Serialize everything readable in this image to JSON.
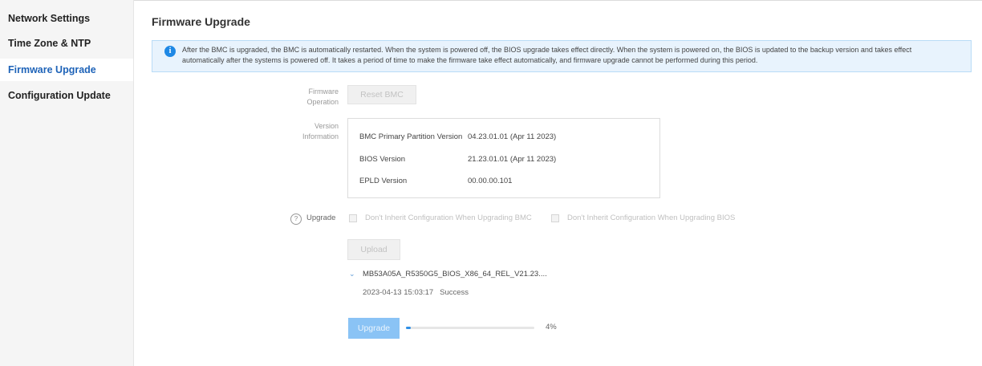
{
  "sidebar": {
    "items": [
      {
        "label": "Network Settings",
        "active": false
      },
      {
        "label": "Time Zone & NTP",
        "active": false
      },
      {
        "label": "Firmware Upgrade",
        "active": true
      },
      {
        "label": "Configuration Update",
        "active": false
      }
    ]
  },
  "main": {
    "title": "Firmware Upgrade",
    "notice": {
      "icon": "info-icon",
      "text": "After the BMC is upgraded, the BMC is automatically restarted. When the system is powered off, the BIOS upgrade takes effect directly. When the system is powered on, the BIOS is updated to the backup version and takes effect automatically after the systems is powered off. It takes a period of time to make the firmware take effect automatically, and firmware upgrade cannot be performed during this period."
    },
    "firmware_operation": {
      "label_line1": "Firmware",
      "label_line2": "Operation",
      "reset_button": "Reset BMC"
    },
    "version_information": {
      "label_line1": "Version",
      "label_line2": "Information",
      "rows": [
        {
          "name": "BMC Primary Partition Version",
          "value": "04.23.01.01  (Apr 11 2023)"
        },
        {
          "name": "BIOS Version",
          "value": "21.23.01.01  (Apr 11 2023)"
        },
        {
          "name": "EPLD Version",
          "value": "00.00.00.101"
        }
      ]
    },
    "upgrade": {
      "label": "Upgrade",
      "help_icon": "?",
      "options": [
        {
          "label": "Don't Inherit Configuration When Upgrading BMC",
          "checked": false
        },
        {
          "label": "Don't Inherit Configuration When Upgrading BIOS",
          "checked": false
        }
      ],
      "upload_button": "Upload",
      "file": {
        "name": "MB53A05A_R5350G5_BIOS_X86_64_REL_V21.23....",
        "timestamp": "2023-04-13 15:03:17",
        "status": "Success"
      },
      "upgrade_button": "Upgrade",
      "progress": {
        "value": 4,
        "text": "4%"
      }
    }
  },
  "colors": {
    "accent": "#1e63b8",
    "notice_bg": "#e8f3fd",
    "progress": "#2f8fe6"
  }
}
